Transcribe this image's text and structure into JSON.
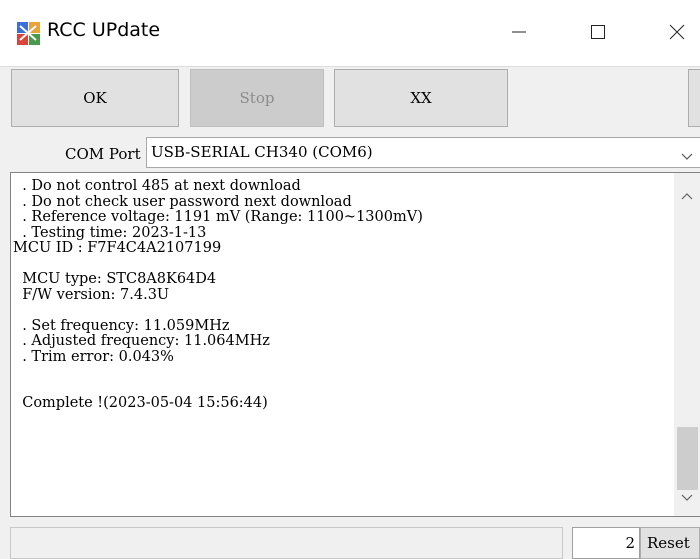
{
  "window": {
    "title": "RCC UPdate",
    "icon": "app-icon",
    "controls": [
      "minimize-icon",
      "maximize-icon",
      "close-icon"
    ]
  },
  "toolbar": {
    "ok_label": "OK",
    "stop_label": "Stop",
    "xx_label": "XX"
  },
  "com": {
    "label": "COM Port",
    "value": "USB-SERIAL CH340 (COM6)"
  },
  "log": {
    "text": "  . Do not control 485 at next download\n  . Do not check user password next download\n  . Reference voltage: 1191 mV (Range: 1100~1300mV)\n  . Testing time: 2023-1-13\nMCU ID : F7F4C4A2107199\n\n  MCU type: STC8A8K64D4\n  F/W version: 7.4.3U\n\n  . Set frequency: 11.059MHz\n  . Adjusted frequency: 11.064MHz\n  . Trim error: 0.043%\n\n\n  Complete !(2023-05-04 15:56:44)"
  },
  "status": {
    "count": "2",
    "reset_label": "Reset"
  }
}
